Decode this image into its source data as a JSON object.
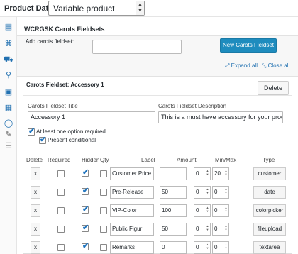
{
  "product_data": {
    "label": "Product Data —",
    "type": "Variable product"
  },
  "section": {
    "title": "WCRGSK Carots Fieldsets",
    "add_label": "Add carots fieldset:",
    "add_value": "",
    "new_button": "New Carots Fieldset",
    "expand_all": "Expand all",
    "close_all": "Close all"
  },
  "fieldset": {
    "title": "Carots Fieldset: Accessory 1",
    "delete_label": "Delete",
    "title_label": "Carots Fieldset Title",
    "title_value": "Accessory 1",
    "desc_label": "Carots Fieldset Description",
    "desc_value": "This is a must have accessory for your product",
    "opt1_label": "At least one option required",
    "opt1_checked": true,
    "opt2_label": "Present conditional",
    "opt2_checked": true
  },
  "table": {
    "headers": [
      "Delete",
      "Required",
      "Hidden",
      "Qty",
      "Label",
      "Amount",
      "Min/Max",
      "Type"
    ],
    "rows": [
      {
        "delete": "x",
        "required": false,
        "hidden": true,
        "qty": false,
        "label": "Customer Price",
        "amount": "",
        "min": "0",
        "max": "20",
        "type": "customer"
      },
      {
        "delete": "x",
        "required": false,
        "hidden": true,
        "qty": false,
        "label": "Pre-Release",
        "amount": "50",
        "min": "0",
        "max": "0",
        "type": "date"
      },
      {
        "delete": "x",
        "required": false,
        "hidden": true,
        "qty": false,
        "label": "VIP-Color",
        "amount": "100",
        "min": "0",
        "max": "0",
        "type": "colorpicker"
      },
      {
        "delete": "x",
        "required": false,
        "hidden": true,
        "qty": false,
        "label": "Public Figur",
        "amount": "50",
        "min": "0",
        "max": "0",
        "type": "fileupload"
      },
      {
        "delete": "x",
        "required": false,
        "hidden": true,
        "qty": false,
        "label": "Remarks",
        "amount": "0",
        "min": "0",
        "max": "0",
        "type": "textarea"
      }
    ]
  },
  "sidebar_icons": [
    "general-icon",
    "inventory-icon",
    "shipping-icon",
    "linked-products-icon",
    "attributes-icon",
    "variations-icon",
    "carots-icon",
    "brush-icon",
    "advanced-icon"
  ]
}
